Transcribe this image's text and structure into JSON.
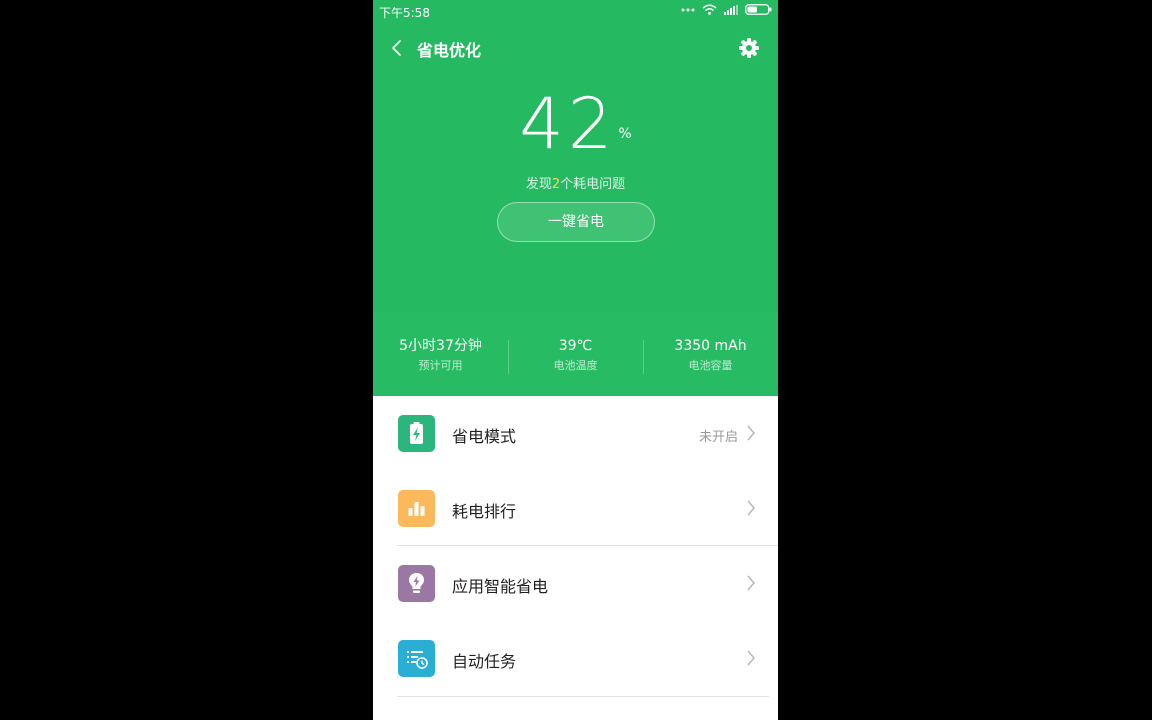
{
  "status_bar": {
    "time": "下午5:58"
  },
  "app_bar": {
    "title": "省电优化"
  },
  "battery": {
    "percent": "42",
    "unit": "%"
  },
  "issues": {
    "prefix": "发现",
    "count": "2",
    "suffix": "个耗电问题"
  },
  "optimize_button": {
    "label": "一键省电"
  },
  "stats": [
    {
      "value": "5小时37分钟",
      "label": "预计可用"
    },
    {
      "value": "39℃",
      "label": "电池温度"
    },
    {
      "value": "3350 mAh",
      "label": "电池容量"
    }
  ],
  "menu": [
    {
      "label": "省电模式",
      "value": "未开启",
      "icon": "battery-bolt-icon",
      "color": "#2bb67e"
    },
    {
      "label": "耗电排行",
      "value": "",
      "icon": "bar-chart-icon",
      "color": "#fcb95b"
    },
    {
      "label": "应用智能省电",
      "value": "",
      "icon": "bulb-bolt-icon",
      "color": "#9b77a4"
    },
    {
      "label": "自动任务",
      "value": "",
      "icon": "task-clock-icon",
      "color": "#2aaed3"
    }
  ]
}
